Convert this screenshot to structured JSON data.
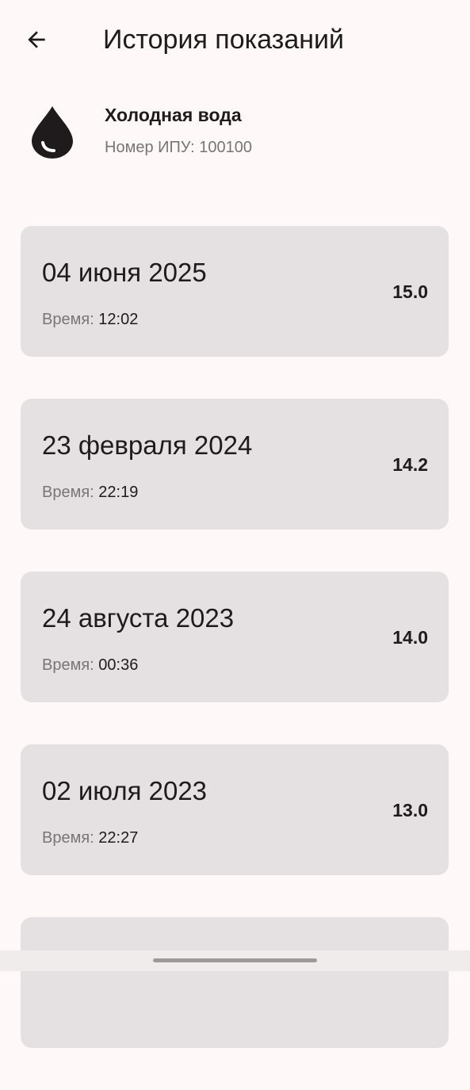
{
  "header": {
    "title": "История показаний",
    "back_icon": "arrow-back-icon"
  },
  "meter": {
    "name": "Холодная вода",
    "number_label": "Номер ИПУ:",
    "number": "100100",
    "icon": "water-drop-icon"
  },
  "readings": [
    {
      "date": "04 июня 2025",
      "time_label": "Время:",
      "time": "12:02",
      "value": "15.0"
    },
    {
      "date": "23 февраля 2024",
      "time_label": "Время:",
      "time": "22:19",
      "value": "14.2"
    },
    {
      "date": "24 августа 2023",
      "time_label": "Время:",
      "time": "00:36",
      "value": "14.0"
    },
    {
      "date": "02 июля 2023",
      "time_label": "Время:",
      "time": "22:27",
      "value": "13.0"
    }
  ],
  "colors": {
    "background": "#FFF8F8",
    "card": "#E5E1E2",
    "text_primary": "#1F1B1C",
    "text_secondary": "#7B7476"
  }
}
